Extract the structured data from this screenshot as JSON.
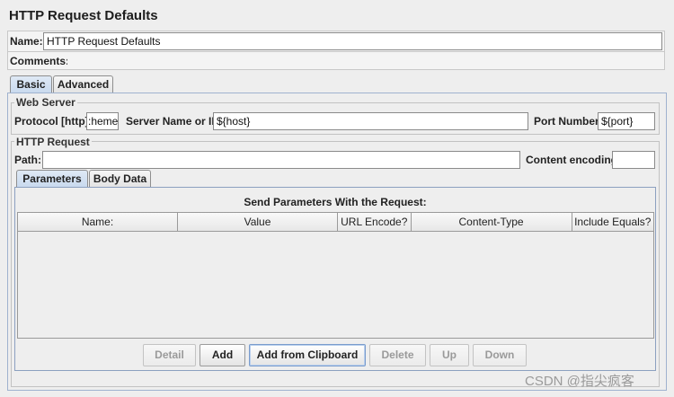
{
  "window": {
    "title": "HTTP Request Defaults"
  },
  "name_row": {
    "label": "Name:",
    "value": "HTTP Request Defaults"
  },
  "comments_row": {
    "label": "Comments:",
    "value": ""
  },
  "tabs": [
    {
      "label": "Basic",
      "active": true
    },
    {
      "label": "Advanced",
      "active": false
    }
  ],
  "web_server": {
    "legend": "Web Server",
    "protocol_label": "Protocol [http]:",
    "protocol_value": ":heme}",
    "server_label": "Server Name or IP:",
    "server_value": "${host}",
    "port_label": "Port Number:",
    "port_value": "${port}"
  },
  "http_request": {
    "legend": "HTTP Request",
    "path_label": "Path:",
    "path_value": "",
    "encoding_label": "Content encoding:",
    "encoding_value": ""
  },
  "sub_tabs": [
    {
      "label": "Parameters",
      "active": true
    },
    {
      "label": "Body Data",
      "active": false
    }
  ],
  "params_table": {
    "title": "Send Parameters With the Request:",
    "columns": [
      "Name:",
      "Value",
      "URL Encode?",
      "Content-Type",
      "Include Equals?"
    ],
    "rows": []
  },
  "buttons": [
    {
      "label": "Detail",
      "enabled": false
    },
    {
      "label": "Add",
      "enabled": true
    },
    {
      "label": "Add from Clipboard",
      "enabled": true
    },
    {
      "label": "Delete",
      "enabled": false
    },
    {
      "label": "Up",
      "enabled": false
    },
    {
      "label": "Down",
      "enabled": false
    }
  ],
  "watermark": "CSDN @指尖疯客"
}
